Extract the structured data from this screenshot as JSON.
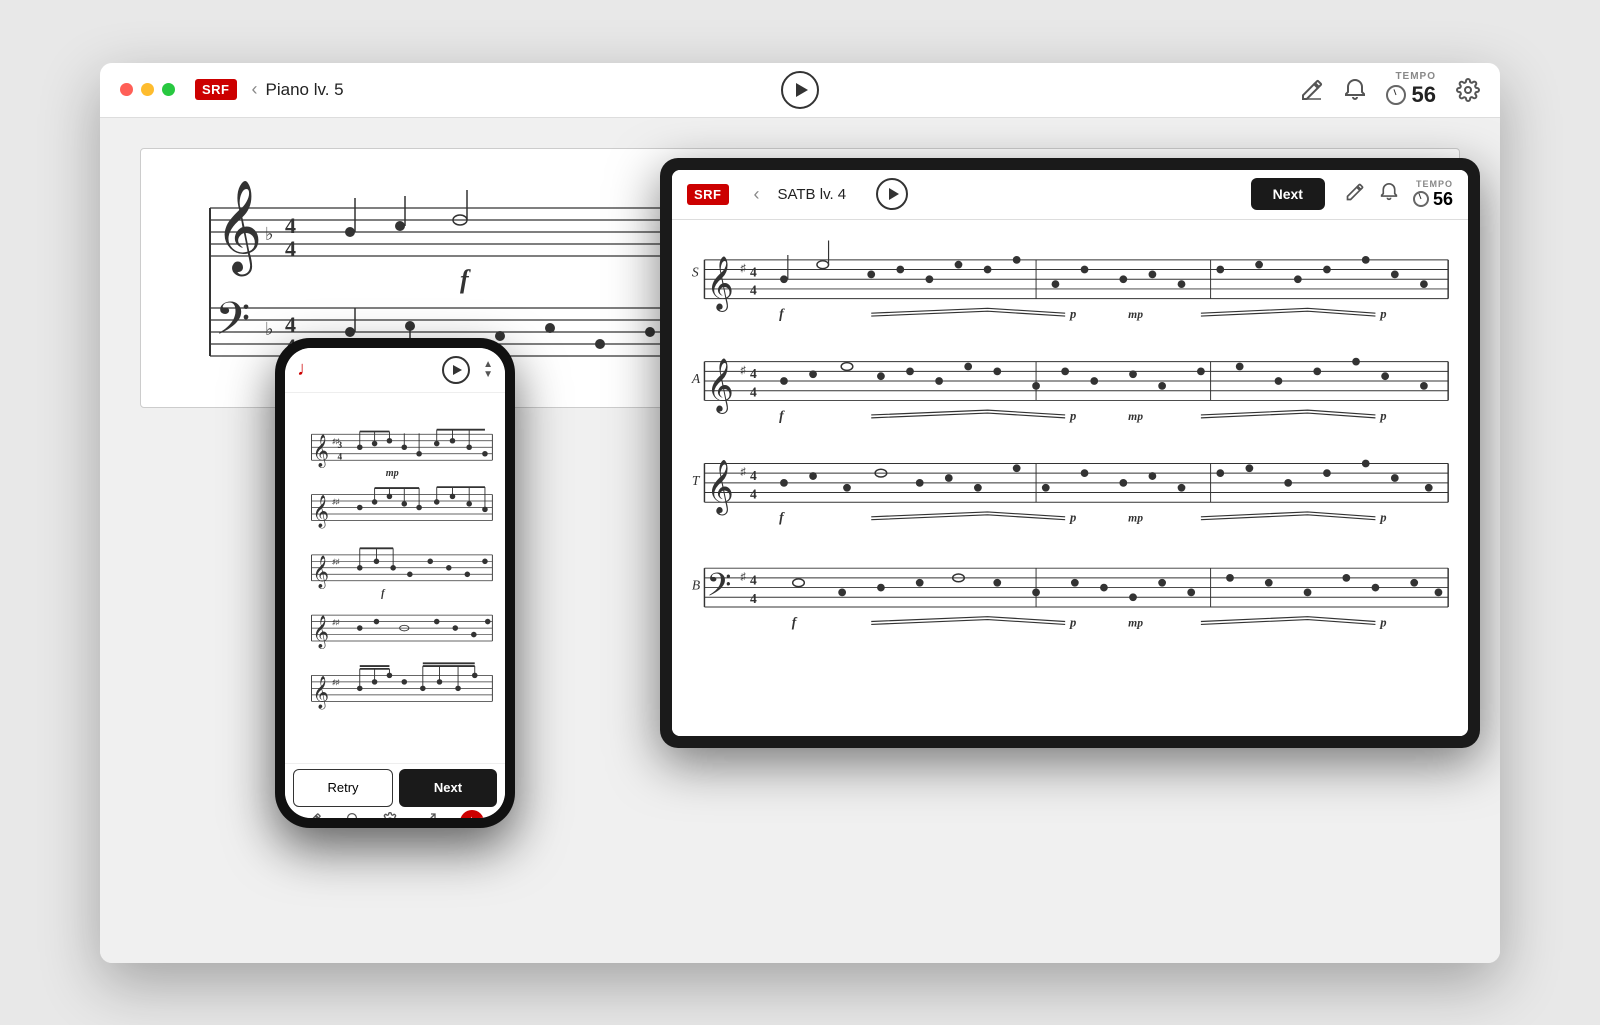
{
  "window": {
    "title": "Piano  lv. 5",
    "controls": [
      "red",
      "yellow",
      "green"
    ]
  },
  "toolbar": {
    "logo": "SRF",
    "back_label": "‹",
    "play_label": "▶",
    "tempo_label": "TEMPO",
    "tempo_value": "56",
    "settings_label": "⚙"
  },
  "tablet": {
    "logo": "SRF",
    "back_label": "‹",
    "title": "SATB  lv. 4",
    "play_label": "▶",
    "next_label": "Next",
    "tempo_label": "TEMPO",
    "tempo_value": "56"
  },
  "phone": {
    "play_label": "▶",
    "retry_label": "Retry",
    "next_label": "Next"
  },
  "icons": {
    "pencil": "✏",
    "bell": "🔔",
    "gear": "⚙",
    "expand": "⛶",
    "star": "★"
  }
}
